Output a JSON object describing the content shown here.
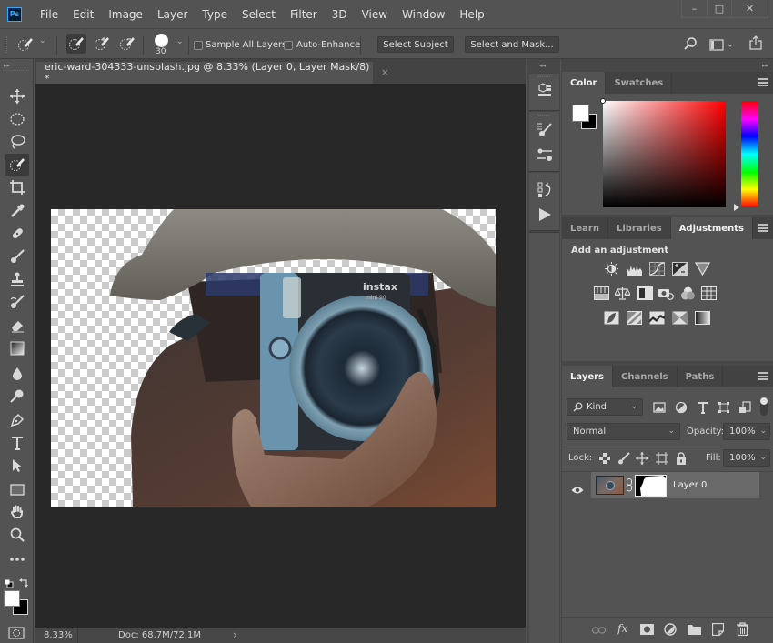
{
  "app": {
    "logo": "Ps",
    "menu": [
      "File",
      "Edit",
      "Image",
      "Layer",
      "Type",
      "Select",
      "Filter",
      "3D",
      "View",
      "Window",
      "Help"
    ],
    "window_controls": {
      "minimize": "–",
      "maximize": "□",
      "close": "✕"
    }
  },
  "options_bar": {
    "brush_size": "30",
    "sample_all_layers_label": "Sample All Layers",
    "sample_all_layers_checked": false,
    "auto_enhance_label": "Auto-Enhance",
    "auto_enhance_checked": false,
    "select_subject_label": "Select Subject",
    "select_and_mask_label": "Select and Mask...",
    "icons": [
      "quick-selection-tool-preset-icon",
      "new-selection-icon",
      "add-to-selection-icon",
      "subtract-from-selection-icon",
      "brush-picker-icon",
      "search-icon",
      "workspace-icon",
      "share-icon"
    ]
  },
  "toolbar": {
    "tools": [
      "move-tool",
      "marquee-tool",
      "lasso-tool",
      "quick-selection-tool",
      "crop-tool",
      "eyedropper-tool",
      "healing-brush-tool",
      "brush-tool",
      "clone-stamp-tool",
      "history-brush-tool",
      "eraser-tool",
      "gradient-tool",
      "blur-tool",
      "dodge-tool",
      "pen-tool",
      "type-tool",
      "path-selection-tool",
      "rectangle-tool",
      "hand-tool",
      "zoom-tool",
      "edit-toolbar"
    ],
    "active_tool": "quick-selection-tool",
    "foreground_color": "#ffffff",
    "background_color": "#000000"
  },
  "document": {
    "tab_title": "eric-ward-304333-unsplash.jpg @ 8.33% (Layer 0, Layer Mask/8) *",
    "close": "×",
    "image_alt": "Person in bucket hat holding an instax mini 90 camera, background removed",
    "camera_brand": "instax",
    "camera_model": "mini 90"
  },
  "status_bar": {
    "zoom": "8.33%",
    "doc_info": "Doc: 68.7M/72.1M",
    "arrow": "›"
  },
  "color_panel": {
    "tabs": [
      "Color",
      "Swatches"
    ],
    "active_tab": "Color",
    "hue_color": "#ff0000",
    "foreground": "#ffffff",
    "background": "#000000"
  },
  "adjustments_panel": {
    "tabs": [
      "Learn",
      "Libraries",
      "Adjustments"
    ],
    "active_tab": "Adjustments",
    "heading": "Add an adjustment",
    "rows": [
      [
        "brightness-contrast",
        "levels",
        "curves",
        "exposure",
        "vibrance"
      ],
      [
        "hue-saturation",
        "color-balance",
        "black-white",
        "photo-filter",
        "channel-mixer",
        "color-lookup"
      ],
      [
        "invert",
        "posterize",
        "threshold",
        "selective-color",
        "gradient-map"
      ]
    ]
  },
  "layers_panel": {
    "tabs": [
      "Layers",
      "Channels",
      "Paths"
    ],
    "active_tab": "Layers",
    "filter_kind": "Kind",
    "blend_mode": "Normal",
    "opacity_label": "Opacity:",
    "opacity": "100%",
    "lock_label": "Lock:",
    "fill_label": "Fill:",
    "fill": "100%",
    "layers": [
      {
        "name": "Layer 0",
        "visible": true,
        "has_mask": true,
        "selected": true
      }
    ],
    "footer_icons": [
      "link-layers",
      "fx",
      "add-mask",
      "adjustment-layer",
      "new-group",
      "new-layer",
      "delete-layer"
    ]
  }
}
